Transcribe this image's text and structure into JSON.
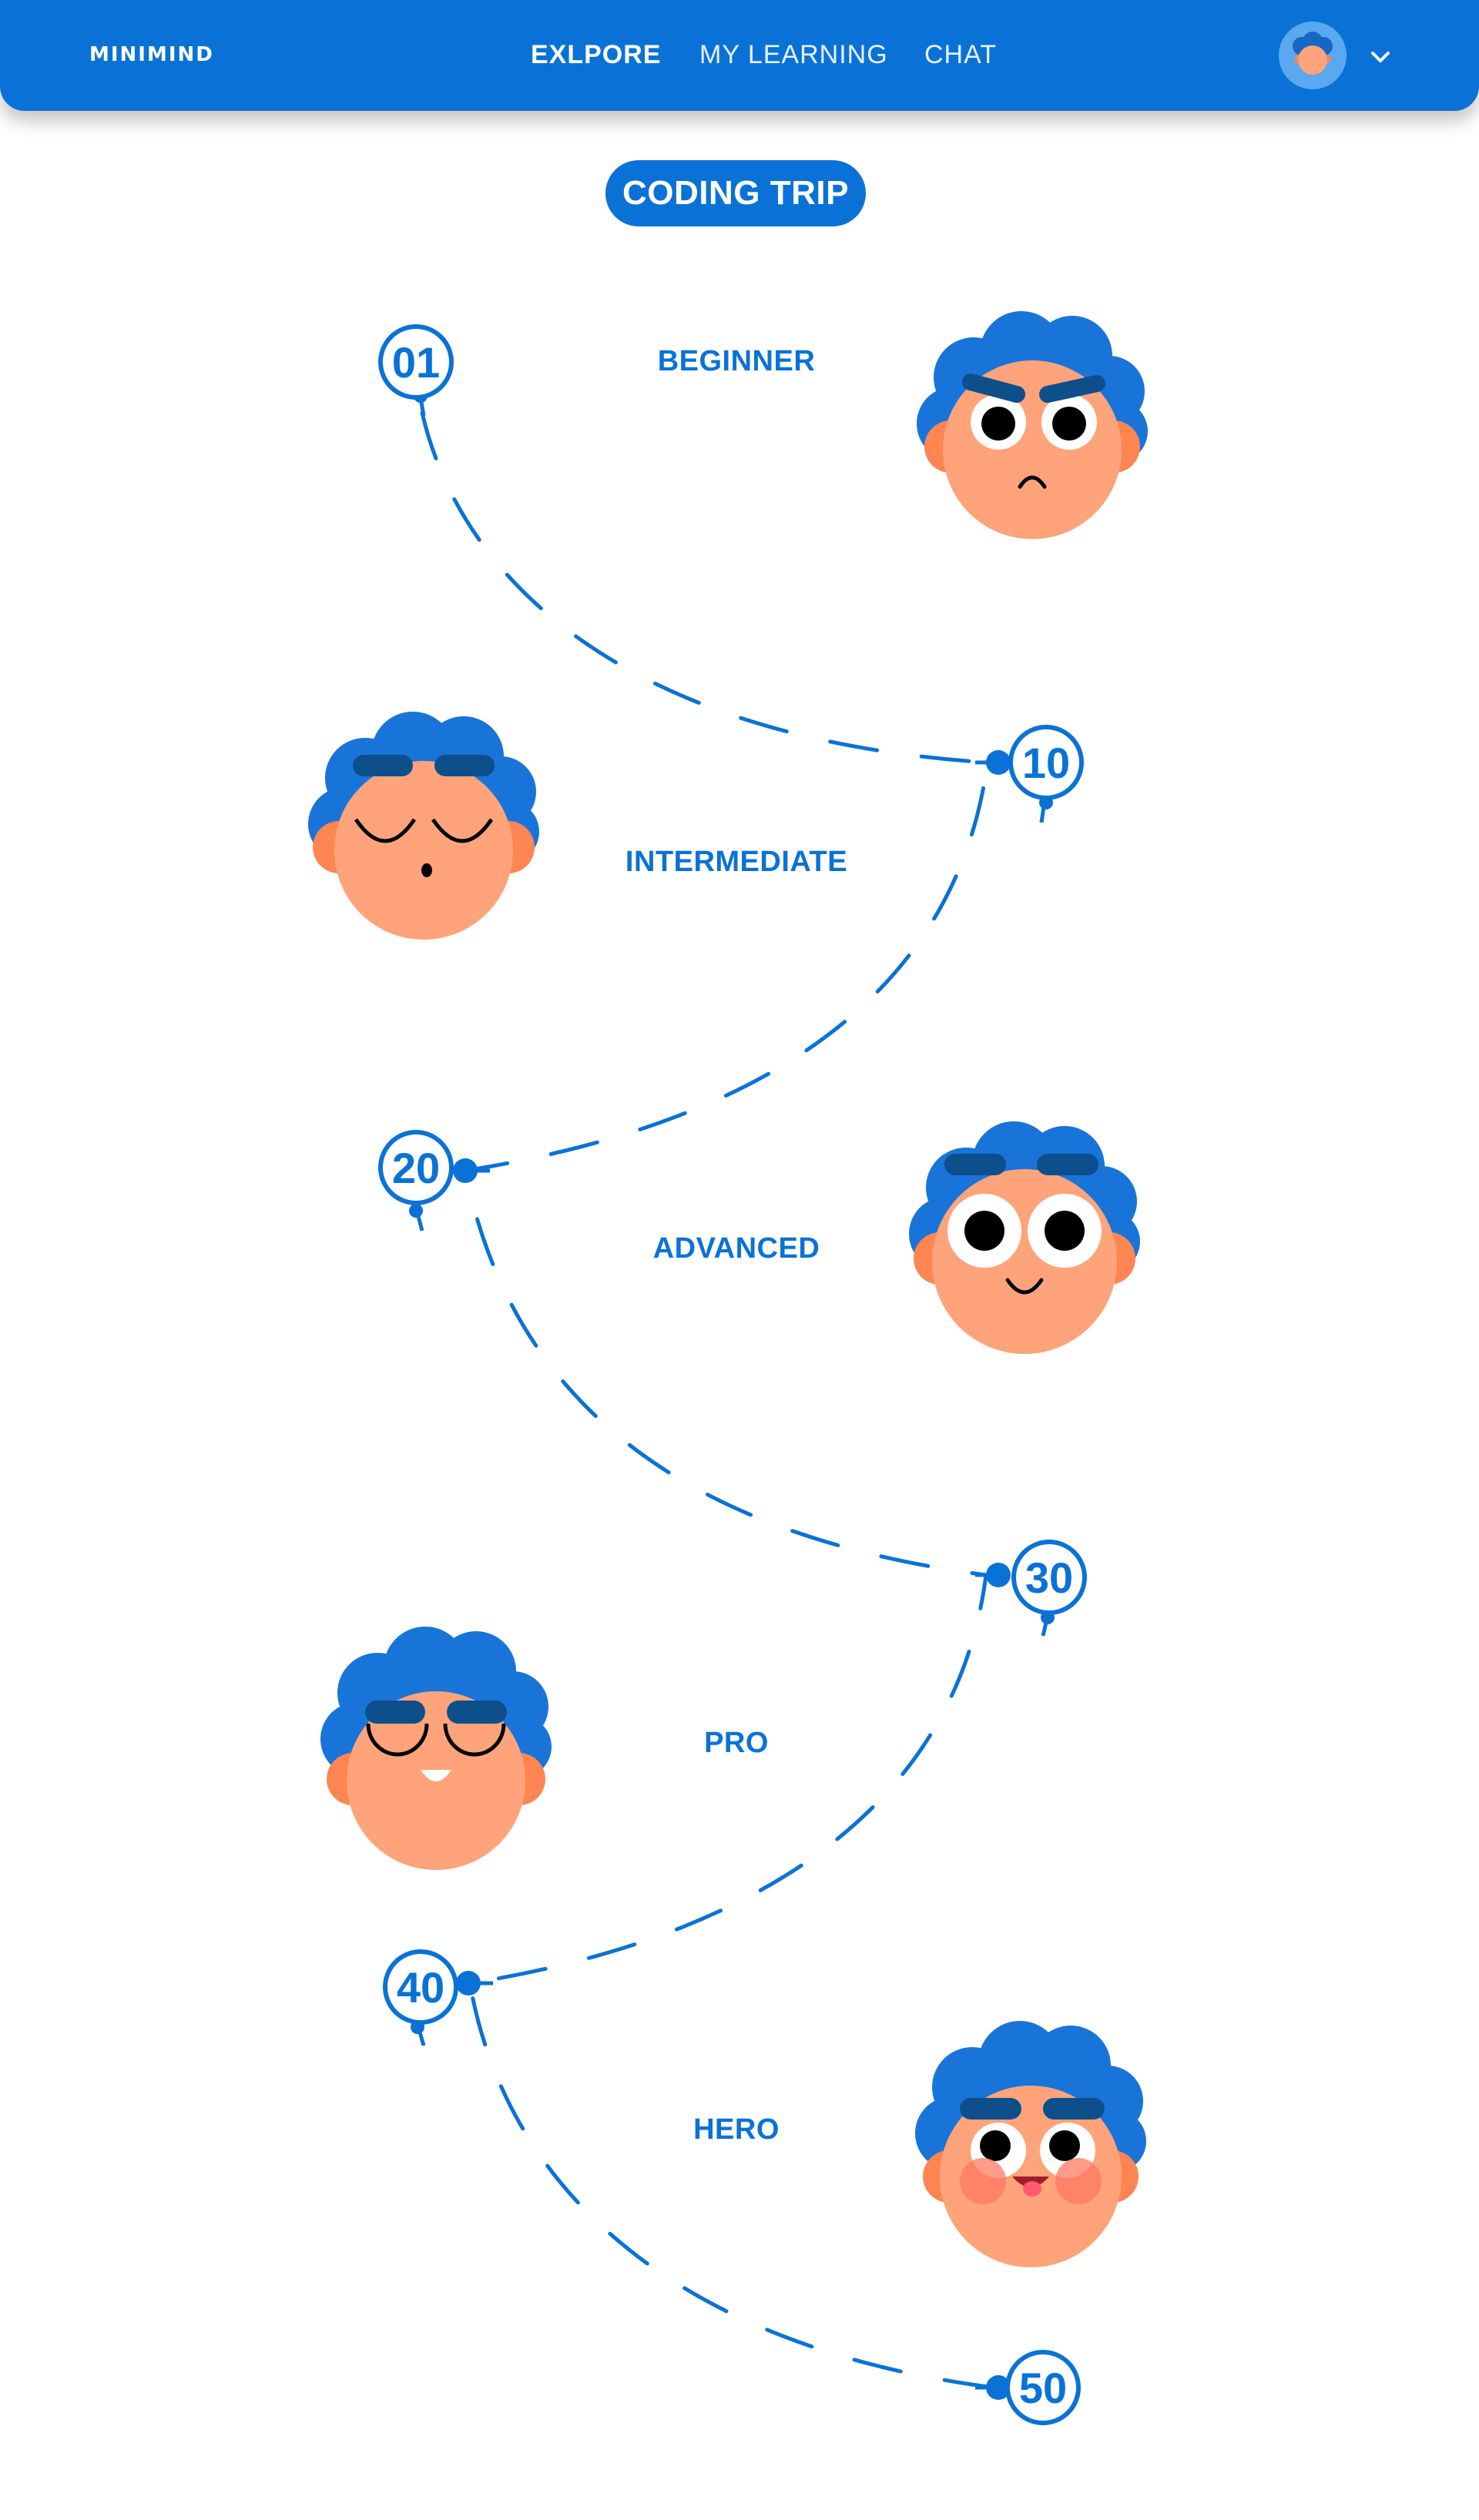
{
  "app": {
    "logo": "MINIMIND"
  },
  "nav": {
    "items": [
      {
        "label": "EXLPORE",
        "active": true
      },
      {
        "label": "MY LEARNING",
        "active": false
      },
      {
        "label": "CHAT",
        "active": false
      }
    ],
    "profile_icon": "avatar-face",
    "dropdown_icon": "chevron-down-icon"
  },
  "page": {
    "title": "CODING TRIP"
  },
  "levels": [
    {
      "name": "BEGINNER",
      "marker": "01",
      "face": "angry"
    },
    {
      "name": "INTERMEDIATE",
      "marker": "10",
      "face": "sleeping"
    },
    {
      "name": "ADVANCED",
      "marker": "20",
      "face": "surprised"
    },
    {
      "name": "PRO",
      "marker": "30",
      "face": "content"
    },
    {
      "name": "HERO",
      "marker": "40",
      "face": "playful"
    }
  ],
  "final_marker": "50",
  "colors": {
    "primary": "#0a72d6",
    "skin": "#ffa47a",
    "ear": "#ff8552",
    "hair": "#1874d8",
    "brow": "#0d4f8a",
    "cheek": "#ff7a61"
  }
}
